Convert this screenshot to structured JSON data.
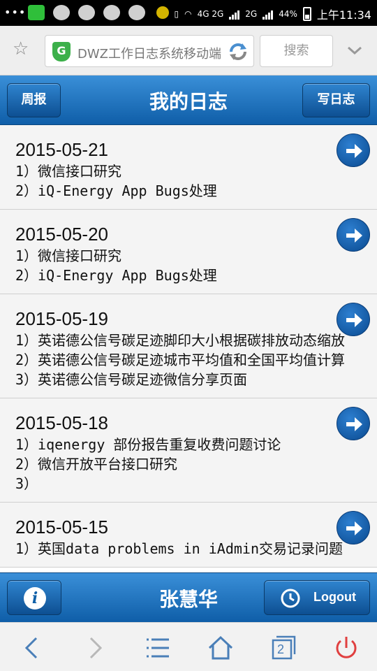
{
  "status_bar": {
    "battery": "44%",
    "time": "上午11:34",
    "network": "4G 2G",
    "network2": "2G"
  },
  "browser": {
    "url_text": "DWZ工作日志系统移动端",
    "search_label": "搜索",
    "tab_count": "2"
  },
  "header": {
    "left_button": "周报",
    "title": "我的日志",
    "right_button": "写日志"
  },
  "entries": [
    {
      "date": "2015-05-21",
      "lines": [
        "1）微信接口研究",
        "2）iQ-Energy App Bugs处理"
      ]
    },
    {
      "date": "2015-05-20",
      "lines": [
        "1）微信接口研究",
        "2）iQ-Energy App Bugs处理"
      ]
    },
    {
      "date": "2015-05-19",
      "lines": [
        "1）英诺德公信号碳足迹脚印大小根据碳排放动态缩放",
        "2）英诺德公信号碳足迹城市平均值和全国平均值计算",
        "3）英诺德公信号碳足迹微信分享页面"
      ]
    },
    {
      "date": "2015-05-18",
      "lines": [
        "1）iqenergy 部份报告重复收费问题讨论",
        "2）微信开放平台接口研究",
        "3）"
      ]
    },
    {
      "date": "2015-05-15",
      "lines": [
        "1）英国data problems in iAdmin交易记录问题"
      ]
    }
  ],
  "footer": {
    "user_name": "张慧华",
    "logout_label": "Logout"
  },
  "colors": {
    "header_top": "#3a8fd8",
    "header_bottom": "#0f5ea8",
    "row_bg": "#f4f4f4",
    "power_red": "#e04040"
  }
}
